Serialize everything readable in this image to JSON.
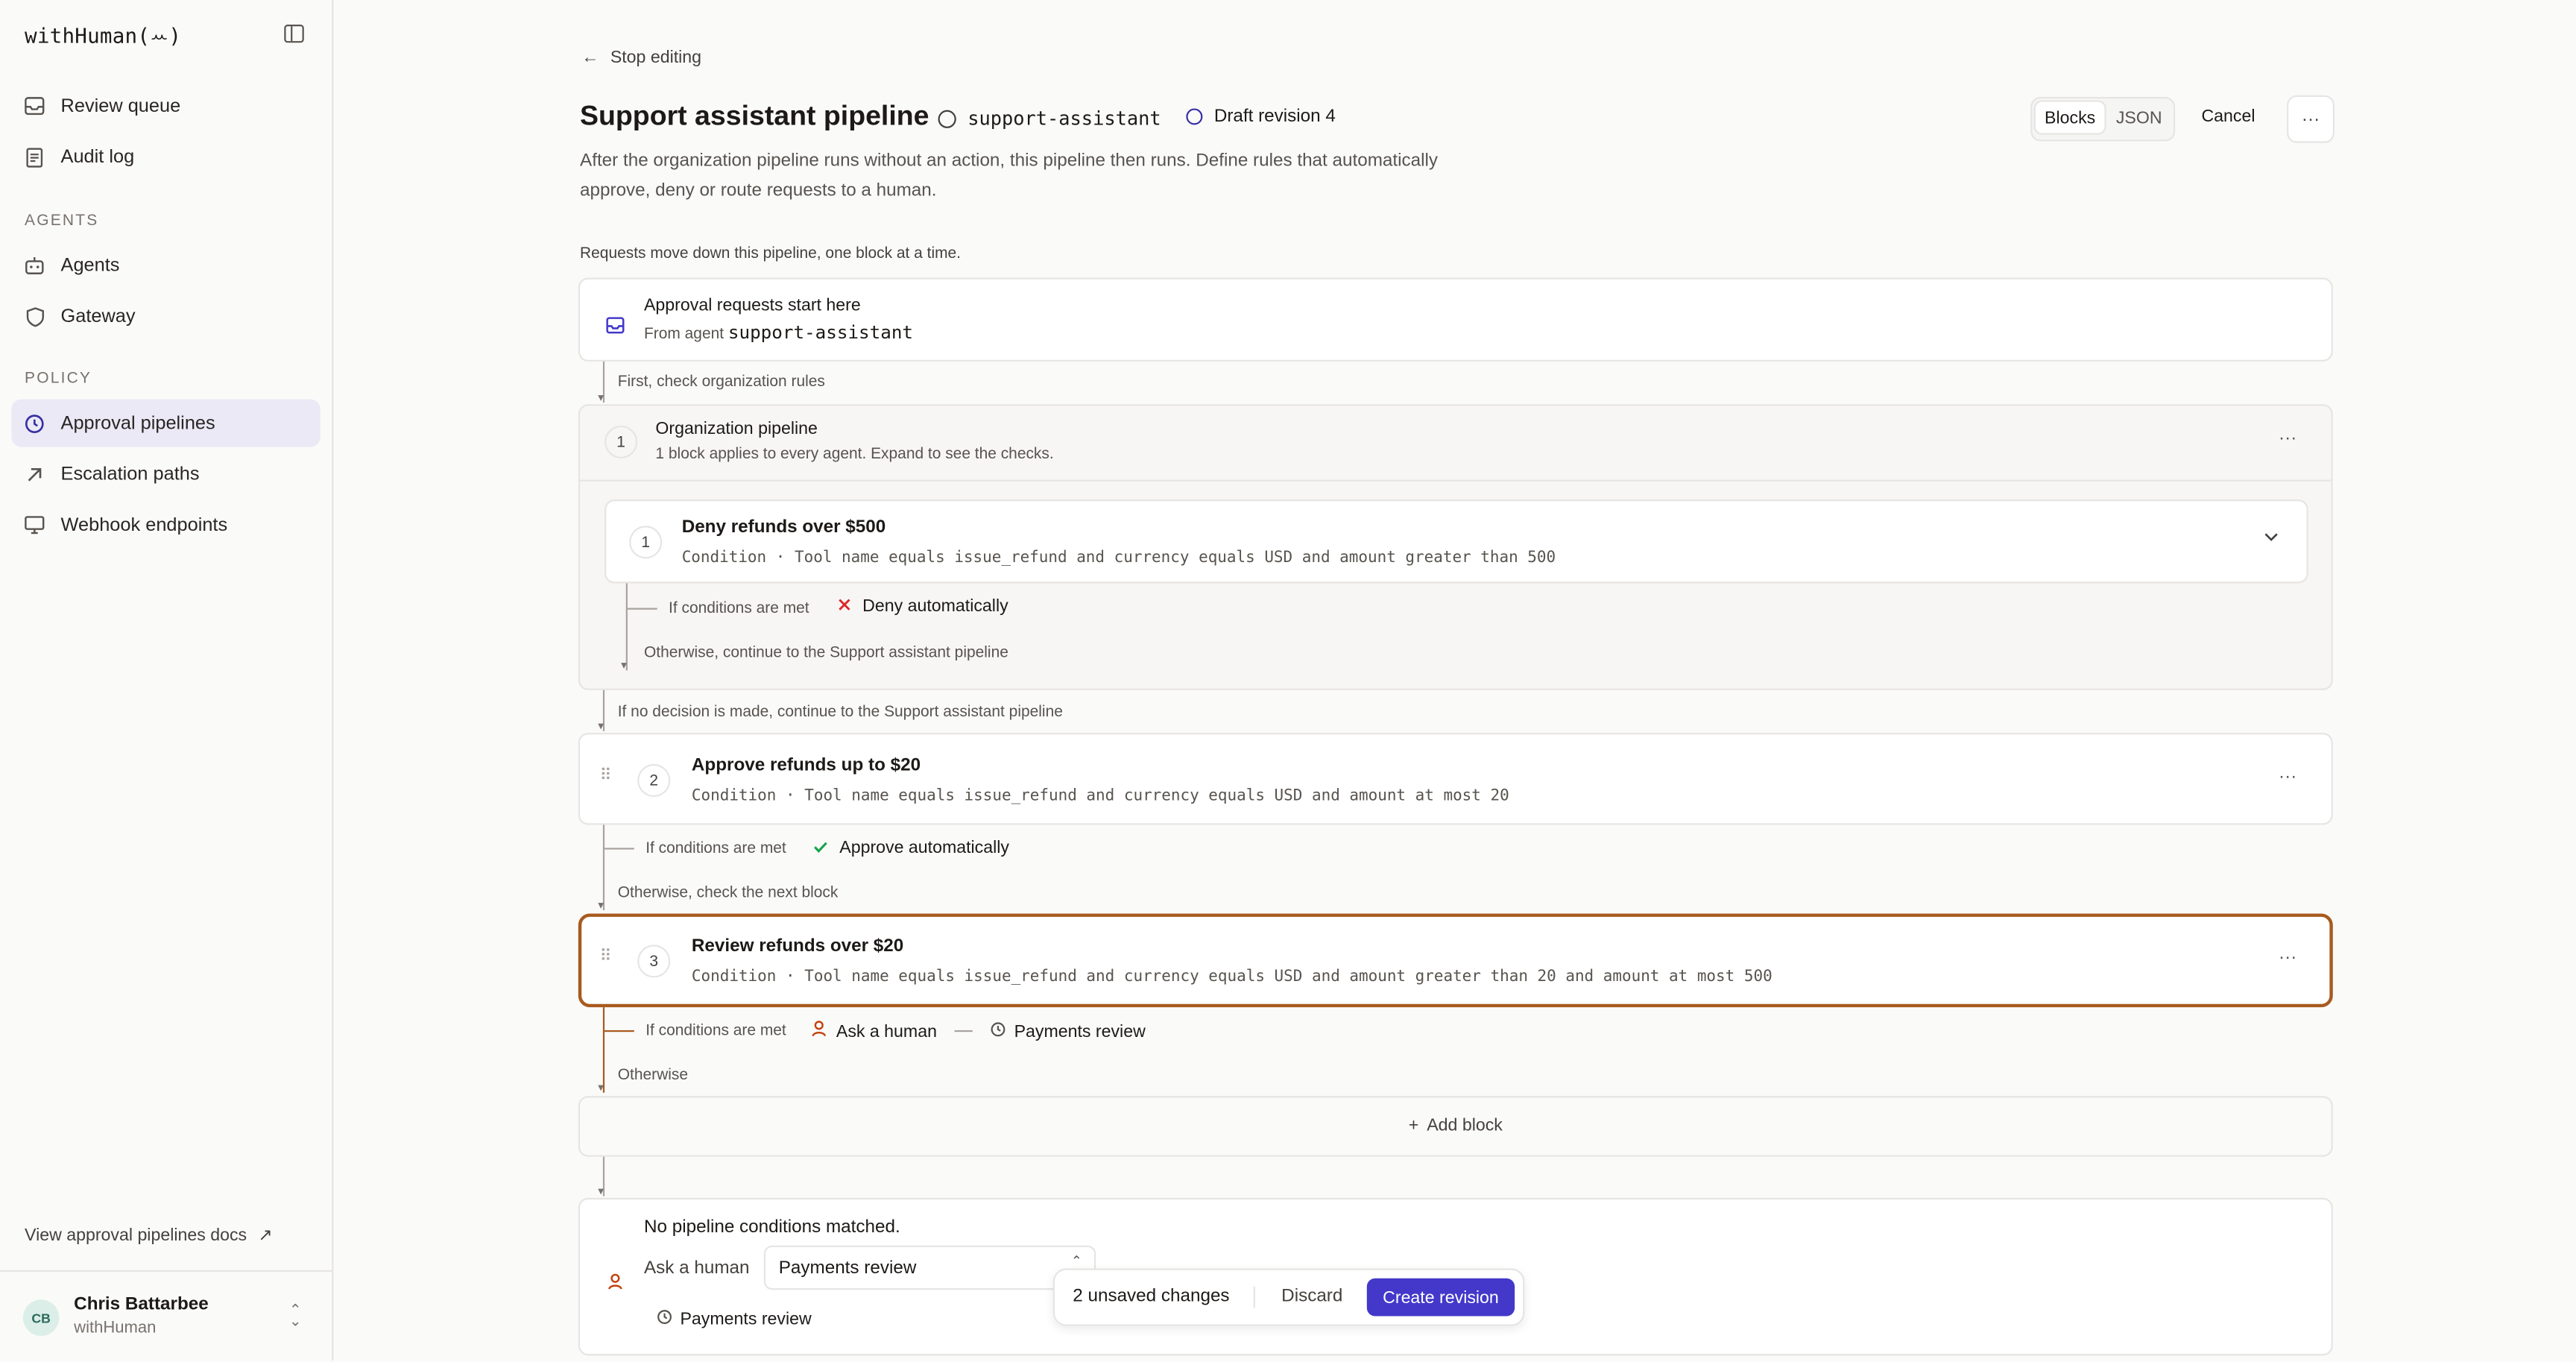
{
  "brand": "withHuman(ꕀ)",
  "sidebar": {
    "items_top": [
      {
        "label": "Review queue",
        "icon": "inbox-icon"
      },
      {
        "label": "Audit log",
        "icon": "document-icon"
      }
    ],
    "agents_header": "AGENTS",
    "agents_items": [
      {
        "label": "Agents",
        "icon": "bot-icon"
      },
      {
        "label": "Gateway",
        "icon": "shield-icon"
      }
    ],
    "policy_header": "POLICY",
    "policy_items": [
      {
        "label": "Approval pipelines",
        "icon": "pipeline-icon",
        "active": true
      },
      {
        "label": "Escalation paths",
        "icon": "arrow-up-right-icon"
      },
      {
        "label": "Webhook endpoints",
        "icon": "monitor-icon"
      }
    ],
    "docs_link": "View approval pipelines docs",
    "user": {
      "initials": "CB",
      "name": "Chris Battarbee",
      "org": "withHuman"
    }
  },
  "header": {
    "back": "Stop editing",
    "title": "Support assistant pipeline",
    "agent": "support-assistant",
    "revision": "Draft revision 4",
    "tabs": [
      "Blocks",
      "JSON"
    ],
    "cancel": "Cancel",
    "description": "After the organization pipeline runs without an action, this pipeline then runs. Define rules that automatically approve, deny or route requests to a human."
  },
  "pipeline": {
    "intro": "Requests move down this pipeline, one block at a time.",
    "start": {
      "title": "Approval requests start here",
      "from_label": "From agent",
      "agent": "support-assistant"
    },
    "org_label": "First, check organization rules",
    "org": {
      "num": "1",
      "title": "Organization pipeline",
      "subtitle": "1 block applies to every agent. Expand to see the checks.",
      "block": {
        "num": "1",
        "title": "Deny refunds over $500",
        "cond_label": "Condition",
        "cond": "Tool name equals issue_refund and currency equals USD and amount greater than 500",
        "if_met": "If conditions are met",
        "outcome": "Deny automatically",
        "otherwise": "Otherwise, continue to the Support assistant pipeline"
      }
    },
    "no_decision": "If no decision is made, continue to the Support assistant pipeline",
    "blocks": [
      {
        "num": "2",
        "title": "Approve refunds up to $20",
        "cond_label": "Condition",
        "cond": "Tool name equals issue_refund and currency equals USD and amount at most 20",
        "if_met": "If conditions are met",
        "outcome": "Approve automatically",
        "otherwise": "Otherwise, check the next block"
      },
      {
        "num": "3",
        "title": "Review refunds over $20",
        "cond_label": "Condition",
        "cond": "Tool name equals issue_refund and currency equals USD and amount greater than 20 and amount at most 500",
        "if_met": "If conditions are met",
        "outcome": "Ask a human",
        "route": "Payments review",
        "otherwise": "Otherwise"
      }
    ],
    "add_block": "Add block",
    "fallback": {
      "title": "No pipeline conditions matched.",
      "ask": "Ask a human",
      "select": "Payments review",
      "route": "Payments review"
    }
  },
  "savebar": {
    "changes": "2 unsaved changes",
    "discard": "Discard",
    "create": "Create revision"
  },
  "colors": {
    "accent": "#4338ca",
    "selected_border": "#a85a1e",
    "deny": "#dc2626",
    "approve": "#16a34a",
    "human": "#c2410c"
  }
}
